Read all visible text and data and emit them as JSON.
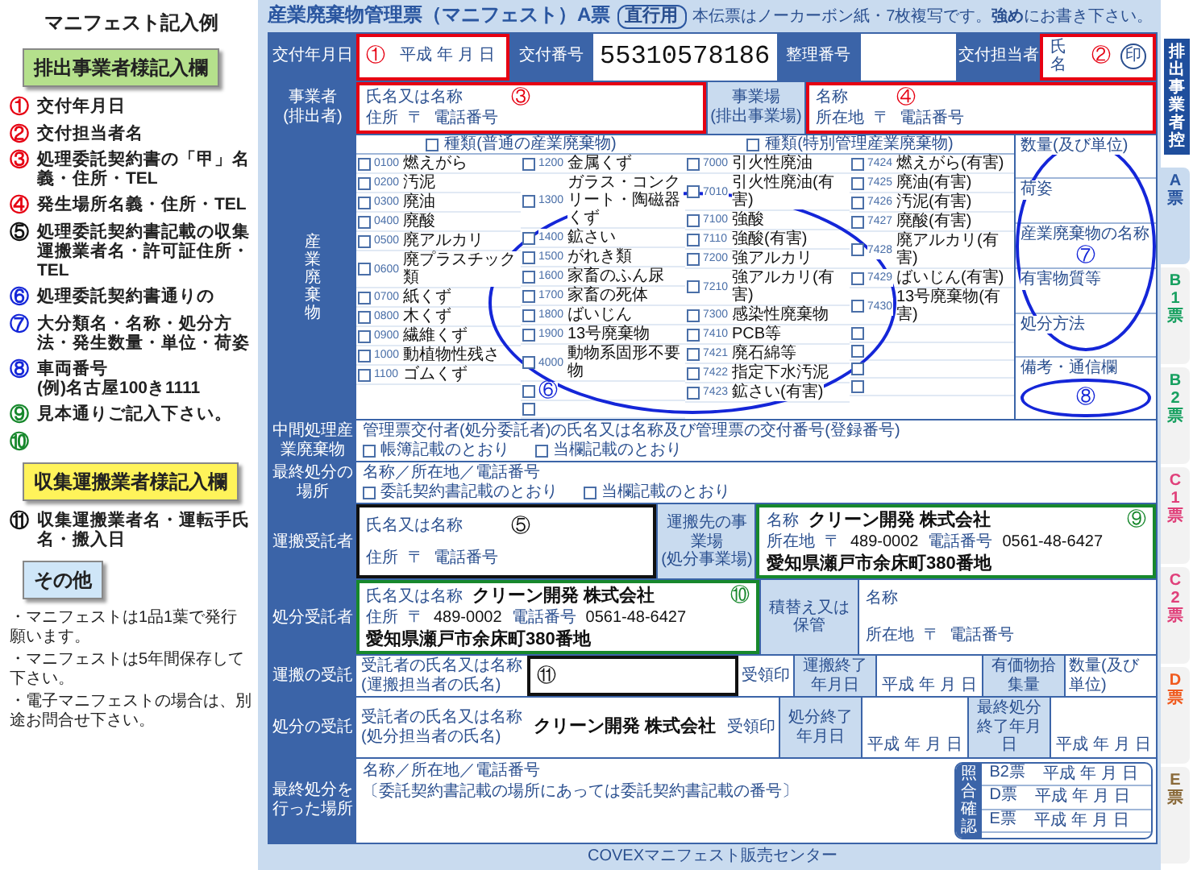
{
  "guide": {
    "title": "マニフェスト記入例",
    "sections": [
      {
        "heading": "排出事業者様記入欄",
        "color": "#b5e08c",
        "items": [
          {
            "mark": "①",
            "color": "#e60012",
            "text": "交付年月日"
          },
          {
            "mark": "②",
            "color": "#e60012",
            "text": "交付担当者名"
          },
          {
            "mark": "③",
            "color": "#e60012",
            "text": "処理委託契約書の「甲」名義・住所・TEL"
          },
          {
            "mark": "④",
            "color": "#e60012",
            "text": "発生場所名義・住所・TEL"
          },
          {
            "mark": "⑤",
            "color": "#111111",
            "text": "処理委託契約書記載の収集運搬業者名・許可証住所・TEL"
          },
          {
            "mark": "⑥",
            "color": "#1426d8",
            "text": "処理委託契約書通りの"
          },
          {
            "mark": "⑦",
            "color": "#1426d8",
            "text": "大分類名・名称・処分方法・発生数量・単位・荷姿"
          },
          {
            "mark": "⑧",
            "color": "#1426d8",
            "text": "車両番号",
            "note": "(例)名古屋100き1111"
          },
          {
            "mark": "⑨",
            "color": "#17882c",
            "text": "見本通りご記入下さい。"
          },
          {
            "mark": "⑩",
            "color": "#17882c"
          }
        ]
      },
      {
        "heading": "収集運搬業者様記入欄",
        "color": "#fff35a",
        "items": [
          {
            "mark": "⑪",
            "color": "#111111",
            "text": "収集運搬業者名・運転手氏名・搬入日"
          }
        ]
      },
      {
        "heading": "その他",
        "color": "#cfe6f8",
        "notes": [
          "・マニフェストは1品1葉で発行願います。",
          "・マニフェストは5年間保存して下さい。",
          "・電子マニフェストの場合は、別途お問合せ下さい。"
        ]
      }
    ]
  },
  "form": {
    "title": "産業廃棄物管理票（マニフェスト）A票",
    "route": "直行用",
    "notice": "本伝票はノーカーボン紙・7枚複写です。**強め**にお書き下さい。",
    "issue": {
      "date_label": "交付年月日",
      "date_marker": "①",
      "date_parts": [
        "平成",
        "年",
        "月",
        "日"
      ],
      "number_label": "交付番号",
      "number": "55310578186",
      "reference_label": "整理番号",
      "person_label": "交付担当者",
      "person_field": "氏名",
      "person_marker": "②",
      "seal": "印"
    },
    "discharger": {
      "label": "事業者",
      "sublabel": "(排出者)",
      "name_label": "氏名又は名称",
      "marker": "③",
      "address_label": "住所",
      "postal": "〒",
      "phone_label": "電話番号"
    },
    "site": {
      "label": "事業場",
      "sublabel": "(排出事業場)",
      "name_label": "名称",
      "marker": "④",
      "address_label": "所在地",
      "postal": "〒",
      "phone_label": "電話番号"
    },
    "waste": {
      "label": "産業廃棄物",
      "marker": "⑥",
      "headings": [
        {
          "text": "種類(普通の産業廃棄物)",
          "checked": false
        },
        {
          "text": "種類(特別管理産業廃棄物)",
          "checked": false
        }
      ],
      "columns": [
        [
          {
            "code": "0100",
            "name": "燃えがら",
            "checked": false
          },
          {
            "code": "0200",
            "name": "汚泥",
            "checked": false
          },
          {
            "code": "0300",
            "name": "廃油",
            "checked": false
          },
          {
            "code": "0400",
            "name": "廃酸",
            "checked": false
          },
          {
            "code": "0500",
            "name": "廃アルカリ",
            "checked": false
          },
          {
            "code": "0600",
            "name": "廃プラスチック類",
            "checked": false
          },
          {
            "code": "0700",
            "name": "紙くず",
            "checked": false
          },
          {
            "code": "0800",
            "name": "木くず",
            "checked": false
          },
          {
            "code": "0900",
            "name": "繊維くず",
            "checked": false
          },
          {
            "code": "1000",
            "name": "動植物性残さ",
            "checked": false
          },
          {
            "code": "1100",
            "name": "ゴムくず",
            "checked": false
          }
        ],
        [
          {
            "code": "1200",
            "name": "金属くず",
            "checked": false
          },
          {
            "code": "1300",
            "name": "ガラス・コンクリート・陶磁器くず",
            "checked": false
          },
          {
            "code": "1400",
            "name": "鉱さい",
            "checked": false
          },
          {
            "code": "1500",
            "name": "がれき類",
            "checked": false
          },
          {
            "code": "1600",
            "name": "家畜のふん尿",
            "checked": false
          },
          {
            "code": "1700",
            "name": "家畜の死体",
            "checked": false
          },
          {
            "code": "1800",
            "name": "ばいじん",
            "checked": false
          },
          {
            "code": "1900",
            "name": "13号廃棄物",
            "checked": false
          },
          {
            "code": "4000",
            "name": "動物系固形不要物",
            "checked": false
          },
          {
            "checked": false
          },
          {
            "checked": false
          }
        ],
        [
          {
            "code": "7000",
            "name": "引火性廃油",
            "checked": false
          },
          {
            "code": "7010",
            "name": "引火性廃油(有害)",
            "checked": false
          },
          {
            "code": "7100",
            "name": "強酸",
            "checked": false
          },
          {
            "code": "7110",
            "name": "強酸(有害)",
            "checked": false
          },
          {
            "code": "7200",
            "name": "強アルカリ",
            "checked": false
          },
          {
            "code": "7210",
            "name": "強アルカリ(有害)",
            "checked": false
          },
          {
            "code": "7300",
            "name": "感染性廃棄物",
            "checked": false
          },
          {
            "code": "7410",
            "name": "PCB等",
            "checked": false
          },
          {
            "code": "7421",
            "name": "廃石綿等",
            "checked": false
          },
          {
            "code": "7422",
            "name": "指定下水汚泥",
            "checked": false
          },
          {
            "code": "7423",
            "name": "鉱さい(有害)",
            "checked": false
          }
        ],
        [
          {
            "code": "7424",
            "name": "燃えがら(有害)",
            "checked": false
          },
          {
            "code": "7425",
            "name": "廃油(有害)",
            "checked": false
          },
          {
            "code": "7426",
            "name": "汚泥(有害)",
            "checked": false
          },
          {
            "code": "7427",
            "name": "廃酸(有害)",
            "checked": false
          },
          {
            "code": "7428",
            "name": "廃アルカリ(有害)",
            "checked": false
          },
          {
            "code": "7429",
            "name": "ばいじん(有害)",
            "checked": false
          },
          {
            "code": "7430",
            "name": "13号廃棄物(有害)",
            "checked": false
          },
          {
            "checked": false
          },
          {
            "checked": false
          },
          {
            "checked": false
          },
          {
            "checked": false
          }
        ]
      ],
      "details": [
        "数量(及び単位)",
        "荷姿",
        "産業廃棄物の名称",
        "有害物質等",
        "処分方法"
      ],
      "details_marker": "⑦",
      "remarks_label": "備考・通信欄",
      "remarks_marker": "⑧"
    },
    "intermediate": {
      "label": "中間処理産業廃棄物",
      "text": "管理票交付者(処分委託者)の氏名又は名称及び管理票の交付番号(登録番号)",
      "options": [
        {
          "text": "帳簿記載のとおり",
          "checked": false
        },
        {
          "text": "当欄記載のとおり",
          "checked": false
        }
      ]
    },
    "final_place": {
      "label": "最終処分の場所",
      "text": "名称／所在地／電話番号",
      "options": [
        {
          "text": "委託契約書記載のとおり",
          "checked": false
        },
        {
          "text": "当欄記載のとおり",
          "checked": false
        }
      ]
    },
    "carrier": {
      "label": "運搬受託者",
      "name_label": "氏名又は名称",
      "marker": "⑤",
      "address_label": "住所",
      "postal": "〒",
      "phone_label": "電話番号"
    },
    "destination": {
      "label": "運搬先の事業場",
      "sublabel": "(処分事業場)",
      "name_label": "名称",
      "name": "クリーン開発 株式会社",
      "marker": "⑨",
      "address_label": "所在地",
      "postal": "〒",
      "postcode": "489-0002",
      "phone_label": "電話番号",
      "phone": "0561-48-6427",
      "address": "愛知県瀬戸市余床町380番地"
    },
    "processor": {
      "label": "処分受託者",
      "name_label": "氏名又は名称",
      "name": "クリーン開発 株式会社",
      "marker": "⑩",
      "address_label": "住所",
      "postal": "〒",
      "postcode": "489-0002",
      "phone_label": "電話番号",
      "phone": "0561-48-6427",
      "address": "愛知県瀬戸市余床町380番地"
    },
    "transfer": {
      "label": "積替え又は保管",
      "name_label": "名称",
      "address_label": "所在地",
      "postal": "〒",
      "phone_label": "電話番号"
    },
    "transport": {
      "label": "運搬の受託",
      "name_label": "受託者の氏名又は名称",
      "sub_label": "(運搬担当者の氏名)",
      "marker": "⑪",
      "seal_label": "受領印",
      "date_label": "運搬終了年月日",
      "date_parts": [
        "平成",
        "年",
        "月",
        "日"
      ],
      "extra_label": "有価物拾集量",
      "quantity_label": "数量(及び単位)"
    },
    "disposal": {
      "label": "処分の受託",
      "name_label": "受託者の氏名又は名称",
      "sub_label": "(処分担当者の氏名)",
      "name": "クリーン開発 株式会社",
      "seal_label": "受領印",
      "date_label": "処分終了年月日",
      "date_parts": [
        "平成",
        "年",
        "月",
        "日"
      ],
      "final_label": "最終処分終了年月日",
      "final_date_parts": [
        "平成",
        "年",
        "月",
        "日"
      ]
    },
    "final_site": {
      "label": "最終処分を行った場所",
      "text": "名称／所在地／電話番号",
      "note": "〔委託契約書記載の場所にあっては委託契約書記載の番号〕"
    },
    "check": {
      "label": "照合確認",
      "rows": [
        {
          "slip": "B2票",
          "parts": [
            "平成",
            "年",
            "月",
            "日"
          ]
        },
        {
          "slip": "D票",
          "parts": [
            "平成",
            "年",
            "月",
            "日"
          ]
        },
        {
          "slip": "E票",
          "parts": [
            "平成",
            "年",
            "月",
            "日"
          ]
        }
      ]
    },
    "footer": "COVEXマニフェスト販売センター"
  },
  "tabs": {
    "copy_label": "排出事業者控",
    "copies": [
      {
        "text": "A票",
        "color": "#2a56a0",
        "selected": true
      },
      {
        "text": "B1票",
        "color": "#17a060",
        "selected": false
      },
      {
        "text": "B2票",
        "color": "#17a060",
        "selected": false
      },
      {
        "text": "C1票",
        "color": "#e0407a",
        "selected": false
      },
      {
        "text": "C2票",
        "color": "#e0407a",
        "selected": false
      },
      {
        "text": "D票",
        "color": "#f05a1e",
        "selected": false
      },
      {
        "text": "E票",
        "color": "#8a6a3a",
        "selected": false
      }
    ]
  }
}
